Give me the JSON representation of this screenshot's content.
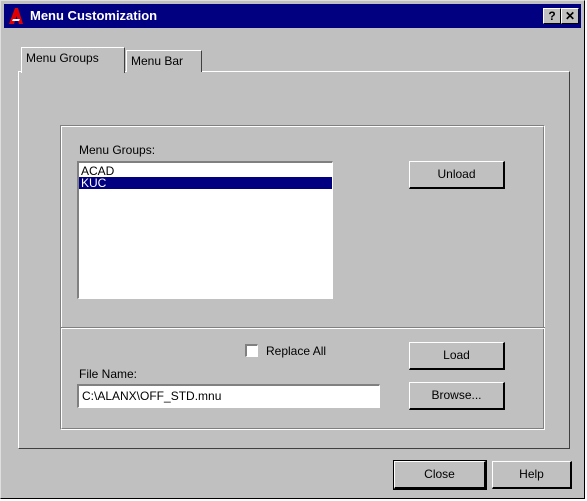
{
  "window": {
    "title": "Menu Customization"
  },
  "titlebar": {
    "help_glyph": "?",
    "close_glyph": "✕"
  },
  "tabs": [
    {
      "label": "Menu Groups",
      "active": true
    },
    {
      "label": "Menu Bar",
      "active": false
    }
  ],
  "menu_groups": {
    "label": "Menu Groups:",
    "items": [
      "ACAD",
      "KUC"
    ],
    "selected": "KUC"
  },
  "buttons": {
    "unload": "Unload",
    "load": "Load",
    "browse": "Browse...",
    "close": "Close",
    "help": "Help"
  },
  "replace_all": {
    "label": "Replace All",
    "checked": false
  },
  "file_name": {
    "label": "File Name:",
    "value": "C:\\ALANX\\OFF_STD.mnu"
  },
  "colors": {
    "titlebar": "#000080",
    "face": "#c0c0c0",
    "selection": "#000080"
  }
}
